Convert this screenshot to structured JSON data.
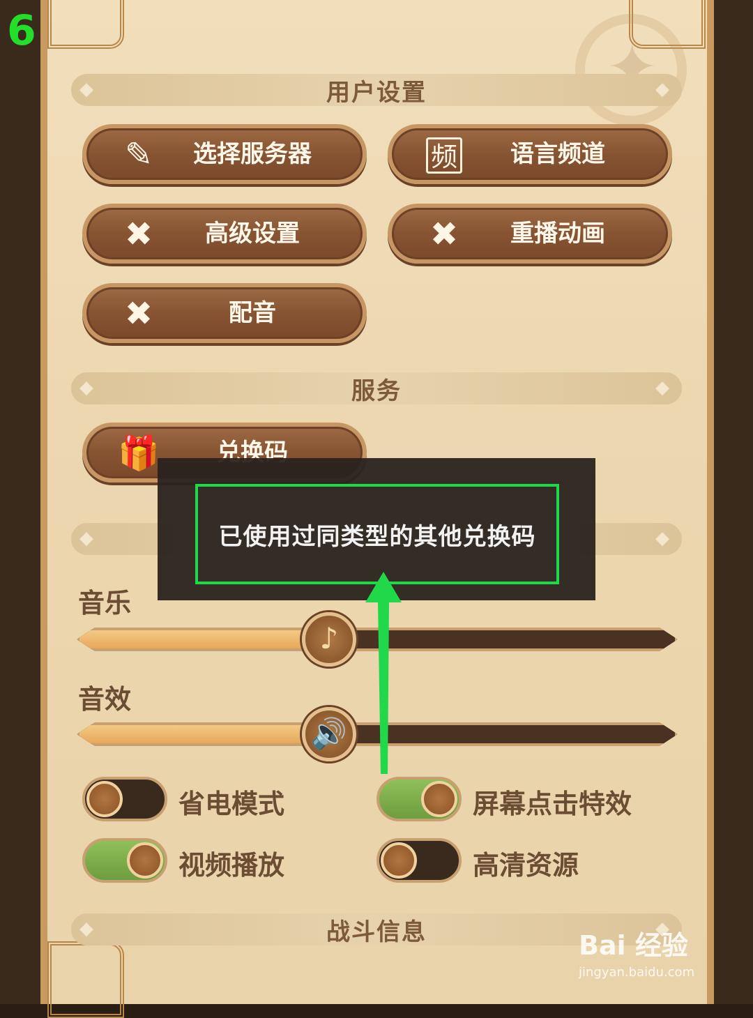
{
  "step_number": "6",
  "sections": {
    "user_settings": "用户设置",
    "service": "服务",
    "battle_info": "战斗信息"
  },
  "buttons": {
    "select_server": "选择服务器",
    "language_channel": "语言频道",
    "language_channel_icon_char": "频",
    "advanced_settings": "高级设置",
    "replay_animation": "重播动画",
    "voice": "配音",
    "redeem_code": "兑换码"
  },
  "audio": {
    "music_label": "音乐",
    "music_level": 0.42,
    "sfx_label": "音效",
    "sfx_level": 0.42
  },
  "toggles": {
    "power_saving": {
      "label": "省电模式",
      "on": false
    },
    "screen_tap_effect": {
      "label": "屏幕点击特效",
      "on": true
    },
    "video_playback": {
      "label": "视频播放",
      "on": true
    },
    "hd_resources": {
      "label": "高清资源",
      "on": false
    }
  },
  "popup": {
    "message": "已使用过同类型的其他兑换码"
  },
  "watermark": {
    "brand": "Bai 经验",
    "url": "jingyan.baidu.com"
  },
  "colors": {
    "highlight": "#21d84a",
    "toggle_on": "#7fb04b"
  }
}
